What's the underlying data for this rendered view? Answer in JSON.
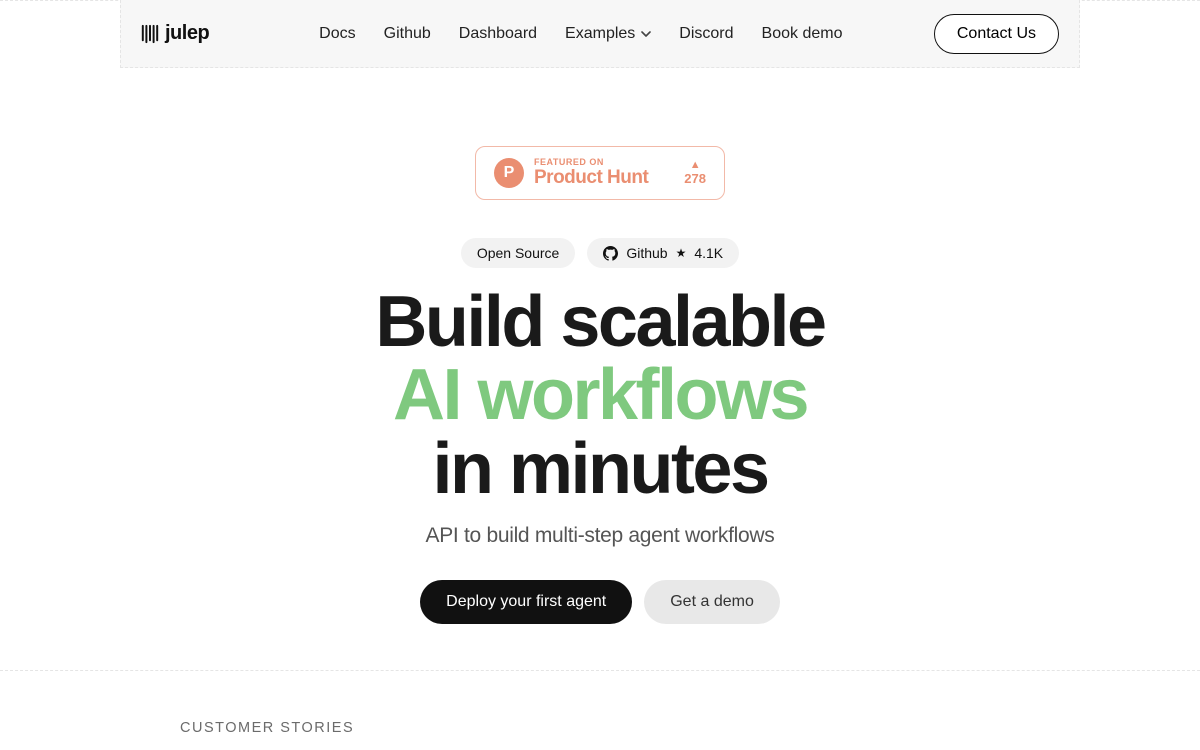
{
  "brand": {
    "name": "julep"
  },
  "nav": {
    "links": {
      "docs": "Docs",
      "github": "Github",
      "dashboard": "Dashboard",
      "examples": "Examples",
      "discord": "Discord",
      "book_demo": "Book demo"
    },
    "contact_label": "Contact Us"
  },
  "product_hunt": {
    "featured_label": "FEATURED ON",
    "name": "Product Hunt",
    "upvotes": "278",
    "badge_letter": "P"
  },
  "pills": {
    "open_source": "Open Source",
    "github_label": "Github",
    "star_count": "4.1K"
  },
  "hero": {
    "line1": "Build scalable",
    "line2": "AI workflows",
    "line3": "in minutes",
    "subhead": "API to build multi-step agent workflows",
    "cta_primary": "Deploy your first agent",
    "cta_secondary": "Get a demo"
  },
  "customer_stories_label": "CUSTOMER STORIES"
}
